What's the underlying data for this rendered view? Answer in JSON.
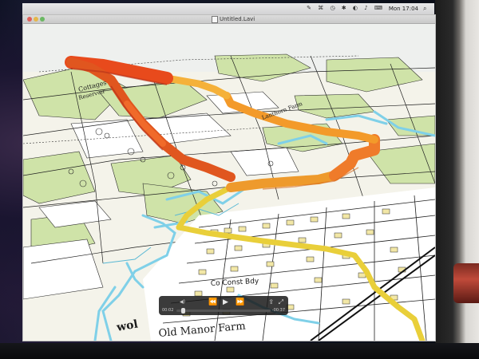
{
  "menubar": {
    "clock": "Mon 17:04",
    "status_icons": "✎ ⌘ ◷ ✱ ◐ ♪ ⌨"
  },
  "window": {
    "title": "Untitled.Lavi"
  },
  "map": {
    "labels": {
      "conduit": "Co Const Bdy",
      "farm": "Old Manor Farm",
      "top_left_1": "Cottages",
      "top_left_2": "Reservoir",
      "top_right": "Lanthorn Farm",
      "bottom_left": "wol"
    }
  },
  "video": {
    "rew_icon": "⏪",
    "play_icon": "▶",
    "ff_icon": "⏩",
    "share_icon": "⇪",
    "expand_icon": "⤢",
    "volume_icon": "◀)",
    "time_elapsed": "00:02",
    "time_remaining": "-00:37",
    "progress": 0.05
  },
  "colors": {
    "route_high": "#e84a1c",
    "route_mid": "#f39a2a",
    "route_low": "#e9cf3a",
    "river": "#7fd0e8",
    "field_green": "#cfe3a8"
  }
}
